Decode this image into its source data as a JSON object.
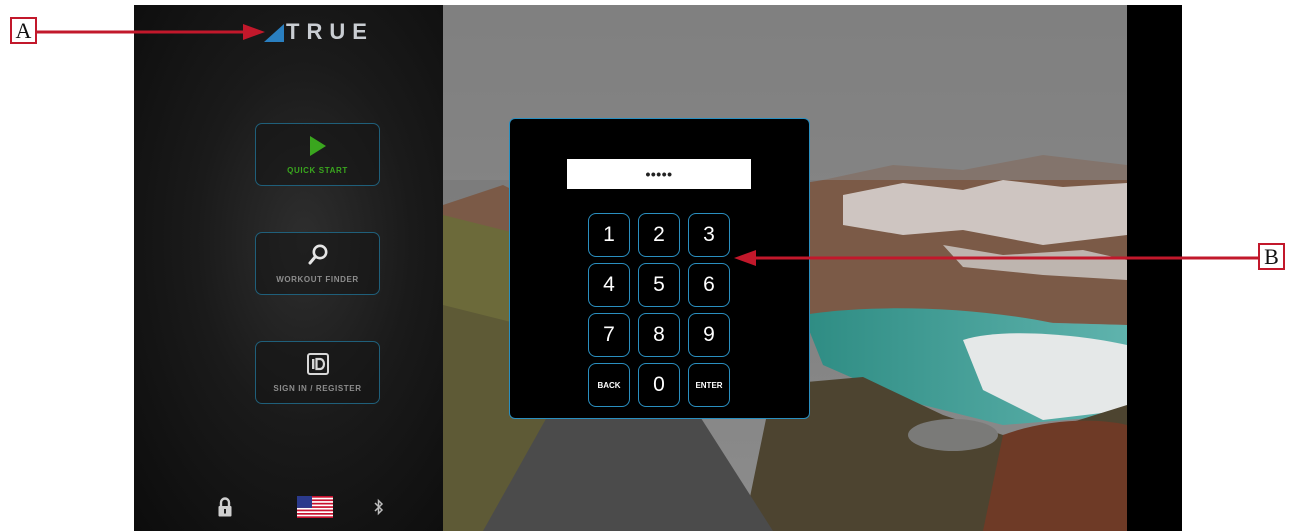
{
  "logo": {
    "text": "TRUE"
  },
  "menu": {
    "quick_start": "QUICK START",
    "workout_finder": "WORKOUT FINDER",
    "sign_in": "SIGN IN / REGISTER"
  },
  "keypad": {
    "pin_value": "•••••",
    "keys": [
      "1",
      "2",
      "3",
      "4",
      "5",
      "6",
      "7",
      "8",
      "9",
      "BACK",
      "0",
      "ENTER"
    ]
  },
  "icons": {
    "quick_start": "play-icon",
    "workout_finder": "search-icon",
    "sign_in": "id-card-icon",
    "lock": "lock-icon",
    "language": "us-flag-icon",
    "bluetooth": "bluetooth-icon"
  },
  "callouts": {
    "a": "A",
    "b": "B"
  },
  "colors": {
    "accent_blue": "#2a8fc0",
    "quick_start_green": "#3aa61e",
    "callout_red": "#c2182b"
  }
}
